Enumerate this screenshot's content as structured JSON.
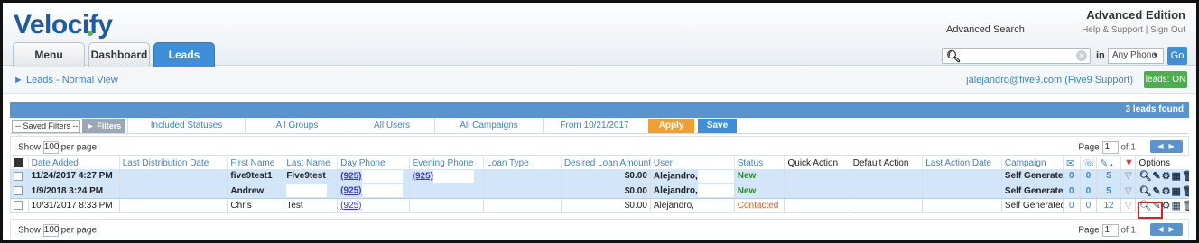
{
  "header": {
    "logo": "Velocify",
    "edition": "Advanced Edition",
    "advanced_search": "Advanced Search",
    "help_link": "Help & Support",
    "sign_out": "Sign Out",
    "tabs": [
      {
        "label": "Menu"
      },
      {
        "label": "Dashboard"
      },
      {
        "label": "Leads"
      }
    ],
    "search": {
      "in_label": "in",
      "phone_option": "Any Phone",
      "go_label": "Go"
    }
  },
  "viewbar": {
    "title": "Leads - Normal View",
    "user_email": "jalejandro@five9.com",
    "user_org": "(Five9 Support)",
    "leads_toggle": "leads: ON"
  },
  "summary": {
    "count_label": "3 leads found"
  },
  "filters": {
    "saved_filters": "-- Saved Filters --",
    "filters_btn": "Filters",
    "included_statuses": "Included Statuses",
    "all_groups": "All Groups",
    "all_users": "All Users",
    "all_campaigns": "All Campaigns",
    "from_date": "From 10/21/2017",
    "apply": "Apply",
    "save": "Save"
  },
  "pager": {
    "show_label": "Show",
    "per_page_value": "100",
    "per_page_label": "per page",
    "page_label": "Page",
    "page_value": "1",
    "of_label": "of 1"
  },
  "columns": {
    "date_added": "Date Added",
    "last_distribution_date": "Last Distribution Date",
    "first_name": "First Name",
    "last_name": "Last Name",
    "day_phone": "Day Phone",
    "evening_phone": "Evening Phone",
    "loan_type": "Loan Type",
    "desired_loan_amount": "Desired Loan Amount",
    "user": "User",
    "status": "Status",
    "quick_action": "Quick Action",
    "default_action": "Default Action",
    "last_action_date": "Last Action Date",
    "campaign": "Campaign",
    "options": "Options"
  },
  "rows": [
    {
      "date_added": "11/24/2017 4:27 PM",
      "first_name": "five9test1",
      "last_name": "Five9test",
      "day_phone": "(925)",
      "evening_phone": "(925)",
      "amount": "$0.00",
      "user": "Alejandro,",
      "status": "New",
      "campaign": "Self Generated",
      "c1": "0",
      "c2": "0",
      "c3": "5"
    },
    {
      "date_added": "1/9/2018 3:24 PM",
      "first_name": "Andrew",
      "last_name": "",
      "day_phone": "(925)",
      "evening_phone": "",
      "amount": "$0.00",
      "user": "Alejandro,",
      "status": "New",
      "campaign": "Self Generated",
      "c1": "0",
      "c2": "0",
      "c3": "5"
    },
    {
      "date_added": "10/31/2017 8:33 PM",
      "first_name": "Chris",
      "last_name": "Test",
      "day_phone": "(925)",
      "evening_phone": "",
      "amount": "$0.00",
      "user": "Alejandro,",
      "status": "Contacted",
      "campaign": "Self Generated",
      "c1": "0",
      "c2": "0",
      "c3": "12"
    }
  ],
  "colors": {
    "accent_blue": "#3e8fd9",
    "bar_blue": "#5a94cc",
    "apply_orange": "#f0a030",
    "on_green": "#4cae4c",
    "highlight_row": "#d3e6f8"
  }
}
